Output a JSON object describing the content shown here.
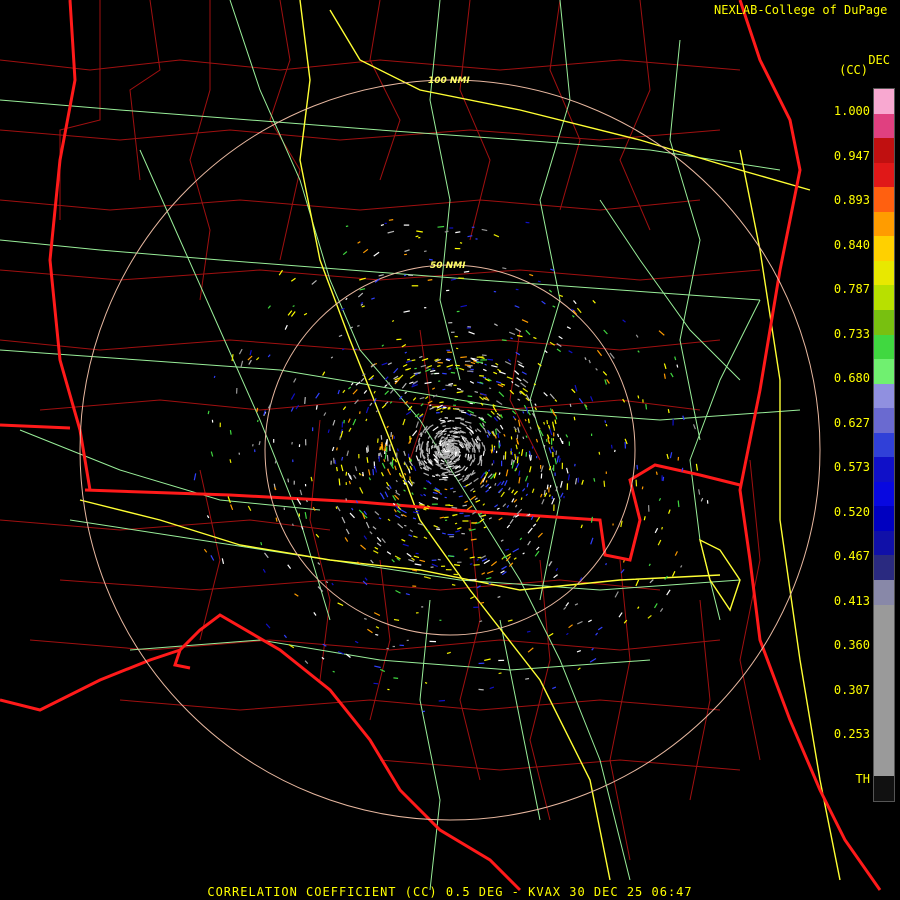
{
  "credit": "NEXLAB-College of DuPage",
  "scale": {
    "unit_top": "DEC",
    "unit_bottom": "(CC)",
    "ticks": [
      "1.000",
      "0.947",
      "0.893",
      "0.840",
      "0.787",
      "0.733",
      "0.680",
      "0.627",
      "0.573",
      "0.520",
      "0.467",
      "0.413",
      "0.360",
      "0.307",
      "0.253",
      "TH"
    ],
    "colors": [
      "#f8a8d0",
      "#e04080",
      "#c01010",
      "#e01818",
      "#ff6010",
      "#ff9c00",
      "#ffd000",
      "#e8e800",
      "#b8e000",
      "#78c010",
      "#40d840",
      "#70f070",
      "#9090e0",
      "#6a6ad0",
      "#3040d8",
      "#1010c8",
      "#0808e0",
      "#0000c0",
      "#1010a8",
      "#2a2a80",
      "#8888a8",
      "#9a9a9a",
      "#9a9a9a",
      "#9a9a9a",
      "#9a9a9a",
      "#9a9a9a",
      "#9a9a9a",
      "#9a9a9a",
      "#111111"
    ]
  },
  "range_rings": {
    "inner_label": "50 NMI",
    "outer_label": "100 NMI"
  },
  "product_title": "CORRELATION COEFFICIENT (CC) 0.5 DEG - KVAX 30 DEC 25 06:47",
  "map_colors": {
    "state_lines": "#ff1a1a",
    "county_lines": "#a01010",
    "interstates": "#ffff33",
    "highways": "#99ee99",
    "rings": "#e8b8a0"
  }
}
